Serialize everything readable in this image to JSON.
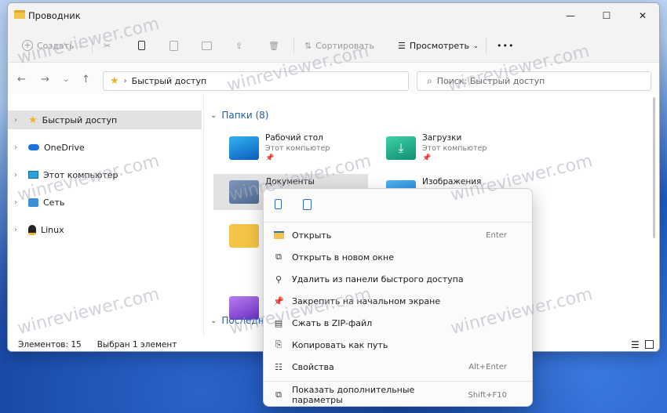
{
  "window": {
    "title": "Проводник"
  },
  "toolbar": {
    "create": "Создать",
    "sort": "Сортировать",
    "view": "Просмотреть",
    "more": "•••"
  },
  "nav": {
    "address": "Быстрый доступ",
    "search_placeholder": "Поиск: Быстрый доступ"
  },
  "sidebar": {
    "items": [
      {
        "label": "Быстрый доступ",
        "icon": "star-icon"
      },
      {
        "label": "OneDrive",
        "icon": "cloud-icon"
      },
      {
        "label": "Этот компьютер",
        "icon": "computer-icon"
      },
      {
        "label": "Сеть",
        "icon": "network-icon"
      },
      {
        "label": "Linux",
        "icon": "linux-icon"
      }
    ]
  },
  "main": {
    "group_folders": "Папки (8)",
    "group_recent": "Последн",
    "tiles": [
      {
        "name": "Рабочий стол",
        "sub": "Этот компьютер"
      },
      {
        "name": "Загрузки",
        "sub": "Этот компьютер"
      },
      {
        "name": "Документы",
        "sub": ""
      },
      {
        "name": "Изображения",
        "sub": ""
      }
    ]
  },
  "status": {
    "items": "Элементов: 15",
    "selected": "Выбран 1 элемент"
  },
  "context_menu": {
    "items": [
      {
        "label": "Открыть",
        "shortcut": "Enter"
      },
      {
        "label": "Открыть в новом окне",
        "shortcut": ""
      },
      {
        "label": "Удалить из панели быстрого доступа",
        "shortcut": ""
      },
      {
        "label": "Закрепить на начальном экране",
        "shortcut": ""
      },
      {
        "label": "Сжать в ZIP-файл",
        "shortcut": ""
      },
      {
        "label": "Копировать как путь",
        "shortcut": ""
      },
      {
        "label": "Свойства",
        "shortcut": "Alt+Enter"
      },
      {
        "label": "Показать дополнительные параметры",
        "shortcut": "Shift+F10"
      }
    ]
  },
  "watermark": "winreviewer.com",
  "colors": {
    "accent": "#1f5b9e",
    "folder": "#f5c345"
  }
}
